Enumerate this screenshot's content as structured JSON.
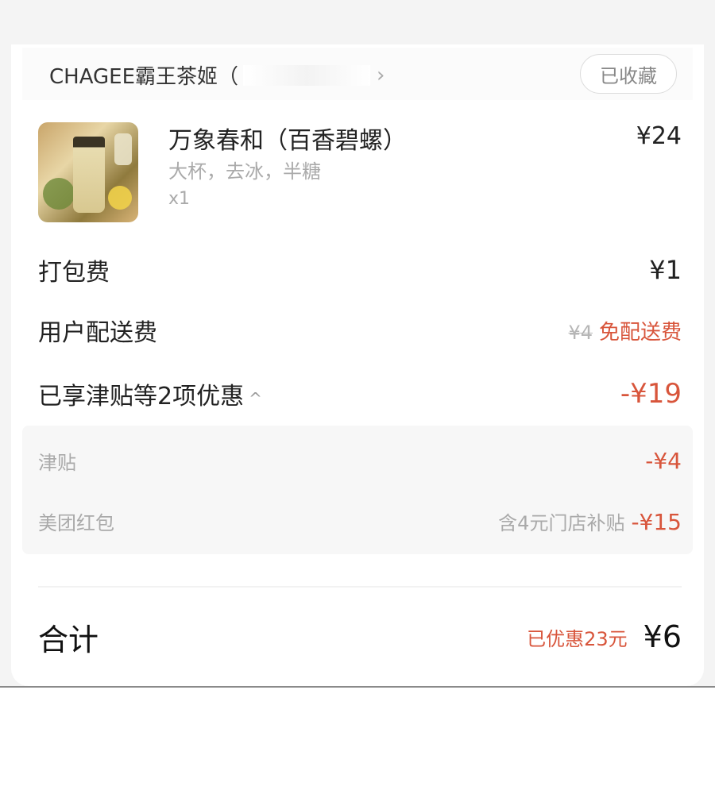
{
  "store": {
    "name": "CHAGEE霸王茶姬（",
    "favorite_label": "已收藏"
  },
  "product": {
    "name": "万象春和（百香碧螺）",
    "options": "大杯，去冰，半糖",
    "quantity": "x1",
    "price": "¥24"
  },
  "fees": {
    "packing_label": "打包费",
    "packing_value": "¥1",
    "delivery_label": "用户配送费",
    "delivery_original": "¥4",
    "delivery_free": "免配送费"
  },
  "discounts": {
    "summary_label": "已享津贴等2项优惠",
    "summary_value": "-¥19",
    "items": [
      {
        "label": "津贴",
        "note": "",
        "value": "-¥4"
      },
      {
        "label": "美团红包",
        "note": "含4元门店补贴",
        "value": "-¥15"
      }
    ]
  },
  "total": {
    "label": "合计",
    "saved": "已优惠23元",
    "value": "¥6"
  },
  "colors": {
    "accent_red": "#d8553b",
    "text_dark": "#222222",
    "text_muted": "#aaaaaa"
  }
}
